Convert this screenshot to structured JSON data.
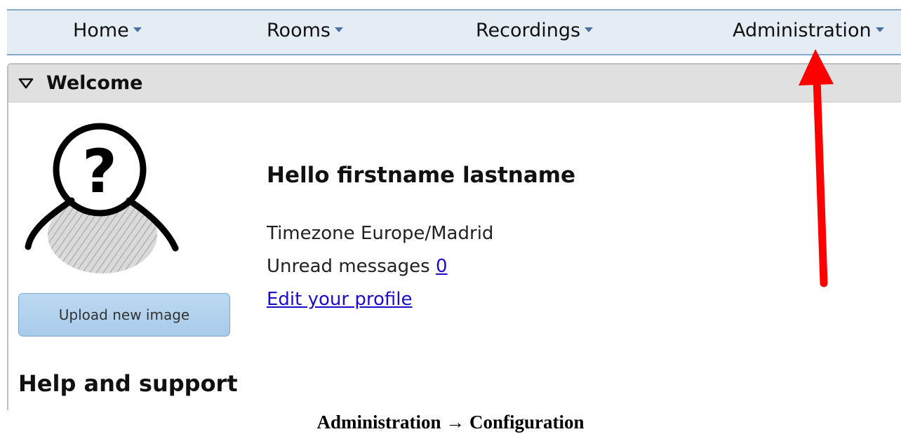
{
  "navbar": {
    "items": [
      {
        "label": "Home"
      },
      {
        "label": "Rooms"
      },
      {
        "label": "Recordings"
      },
      {
        "label": "Administration"
      }
    ]
  },
  "welcome_panel": {
    "title": "Welcome",
    "upload_button_label": "Upload new image",
    "greeting": "Hello firstname lastname",
    "timezone_label": "Timezone",
    "timezone_value": "Europe/Madrid",
    "unread_label": "Unread messages",
    "unread_count": "0",
    "edit_profile_label": "Edit your profile",
    "help_heading": "Help and support"
  },
  "annotation": {
    "arrow_color": "#ff0000"
  },
  "caption": {
    "from": "Administration",
    "arrow": "→",
    "to": "Configuration"
  },
  "colors": {
    "navbar_bg": "#e4ecf4",
    "navbar_border": "#86a8c8",
    "panel_header_bg": "#e0e0e0",
    "button_bg": "#a8cbea",
    "link": "#1a0dcc"
  }
}
